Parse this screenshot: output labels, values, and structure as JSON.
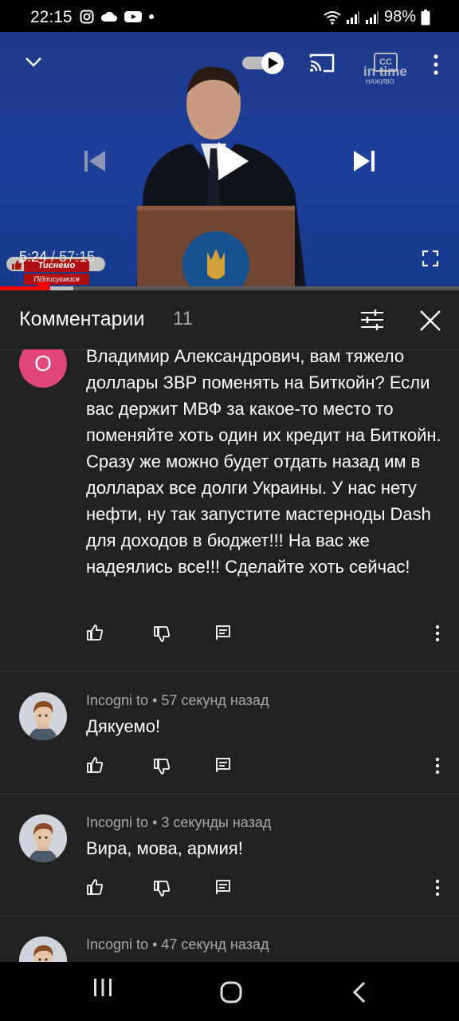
{
  "status_bar": {
    "time": "22:15",
    "battery": "98%",
    "icons": [
      "instagram-icon",
      "cloud-icon",
      "youtube-icon",
      "dot-icon",
      "wifi-icon",
      "signal-icon",
      "signal-icon",
      "battery-icon"
    ]
  },
  "player": {
    "current_time": "5:24",
    "duration": "57:15",
    "time_separator": " / ",
    "progress_fraction": 0.094,
    "buffered_fraction": 0.16,
    "overlay_badge": {
      "line1": "Тиснемо",
      "line2": "Підписуємося"
    },
    "watermark": {
      "brand": "in time",
      "sub": "НАЖИВО"
    },
    "cc_label": "CC",
    "accent": "#ff0000"
  },
  "comments_panel": {
    "title": "Комментарии",
    "count": "11"
  },
  "comments": [
    {
      "avatar_letter": "О",
      "avatar_color": "#e0457b",
      "text": "Владимир Александрович,  вам тяжело доллары ЗВР поменять на Биткойн? Если вас держит МВФ за какое-то место то поменяйте хоть один их кредит на Биткойн. Сразу же можно будет отдать назад им в долларах все долги Украины. У нас нету нефти,  ну так запустите мастерноды Dash для доходов в бюджет!!! На вас же надеялись все!!! Сделайте хоть сейчас!"
    },
    {
      "author": "Incogni to",
      "time": "57 секунд назад",
      "text": "Дякуемо!"
    },
    {
      "author": "Incogni to",
      "time": "3 секунды назад",
      "text": "Вира, мова, армия!"
    },
    {
      "author": "Incogni to",
      "time": "47 секунд назад",
      "text": ""
    }
  ]
}
